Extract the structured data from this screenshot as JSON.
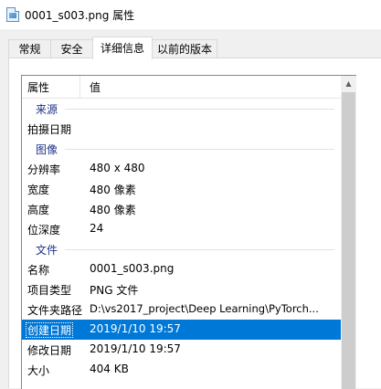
{
  "window": {
    "title": "0001_s003.png 属性",
    "file_icon": "image-file-icon"
  },
  "tabs": [
    {
      "label": "常规",
      "active": false
    },
    {
      "label": "安全",
      "active": false
    },
    {
      "label": "详细信息",
      "active": true
    },
    {
      "label": "以前的版本",
      "active": false
    }
  ],
  "details": {
    "header": {
      "property": "属性",
      "value": "值"
    },
    "groups": {
      "source": "来源",
      "image": "图像",
      "file": "文件"
    },
    "rows": {
      "date_taken": {
        "key": "拍摄日期",
        "value": ""
      },
      "dimensions": {
        "key": "分辨率",
        "value": "480 x 480"
      },
      "width": {
        "key": "宽度",
        "value": "480 像素"
      },
      "height": {
        "key": "高度",
        "value": "480 像素"
      },
      "bit_depth": {
        "key": "位深度",
        "value": "24"
      },
      "name": {
        "key": "名称",
        "value": "0001_s003.png"
      },
      "item_type": {
        "key": "项目类型",
        "value": "PNG 文件"
      },
      "folder_path": {
        "key": "文件夹路径",
        "value": "D:\\vs2017_project\\Deep Learning\\PyTorch..."
      },
      "date_created": {
        "key": "创建日期",
        "value": "2019/1/10 19:57",
        "selected": true
      },
      "date_modified": {
        "key": "修改日期",
        "value": "2019/1/10 19:57"
      },
      "size": {
        "key": "大小",
        "value": "404 KB"
      }
    }
  },
  "colors": {
    "selection": "#0078d7",
    "group_heading": "#1e3287"
  }
}
